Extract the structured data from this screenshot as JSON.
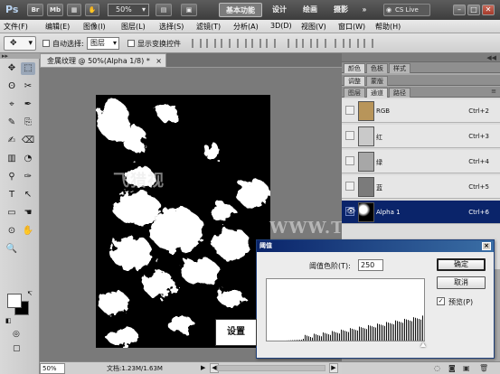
{
  "appbar": {
    "logo": "Ps",
    "bridge": "Br",
    "minibridge": "Mb",
    "zoom": "50%",
    "workspaces": [
      "基本功能",
      "设计",
      "绘画",
      "摄影"
    ],
    "more": "»",
    "cslive": "CS Live",
    "minimize": "–",
    "restore": "□",
    "close": "✕"
  },
  "menubar": {
    "items": [
      "文件(F)",
      "编辑(E)",
      "图像(I)",
      "图层(L)",
      "选择(S)",
      "滤镜(T)",
      "分析(A)",
      "3D(D)",
      "视图(V)",
      "窗口(W)",
      "帮助(H)"
    ]
  },
  "options": {
    "auto_select": "自动选择:",
    "auto_select_value": "图层",
    "show_transform": "显示变换控件"
  },
  "toolbox": {
    "grip": "▸▸",
    "tool_glyphs": [
      "✥",
      "⬚",
      "ʘ",
      "✂",
      "⌖",
      "✒",
      "✎",
      "⎘",
      "✍",
      "⌫",
      "▥",
      "◔",
      "⚲",
      "✑",
      "T",
      "↖",
      "▭",
      "☚",
      "⊙",
      "✋",
      "🔍"
    ],
    "swap": "↸",
    "quickmask": "◎",
    "screenmode": "▢"
  },
  "document": {
    "tab_title": "金属纹理 @ 50%(Alpha 1/8) *",
    "tab_close": "×",
    "watermarks": [
      "飞猎视",
      "WWW.TTLVI.NET"
    ]
  },
  "statusbar": {
    "zoom": "50%",
    "doc_info": "文档:1.23M/1.63M",
    "arrow": "▶",
    "scroll_left": "◀",
    "scroll_right": "▶"
  },
  "panels": {
    "collapse": "◀◀",
    "group1_tabs": [
      "颜色",
      "色板",
      "样式"
    ],
    "group2_tabs": [
      "调整",
      "蒙版"
    ],
    "group3_tabs": [
      "图层",
      "通道",
      "路径"
    ],
    "active_tab": "通道",
    "menu_icon": "≡",
    "channels": [
      {
        "name": "RGB",
        "shortcut": "Ctrl+2",
        "thumb": "#b8955a",
        "visible": false,
        "selected": false
      },
      {
        "name": "红",
        "shortcut": "Ctrl+3",
        "thumb": "#c9c9c9",
        "visible": false,
        "selected": false
      },
      {
        "name": "绿",
        "shortcut": "Ctrl+4",
        "thumb": "#a7a7a7",
        "visible": false,
        "selected": false
      },
      {
        "name": "蓝",
        "shortcut": "Ctrl+5",
        "thumb": "#7b7b7b",
        "visible": false,
        "selected": false
      },
      {
        "name": "Alpha 1",
        "shortcut": "Ctrl+6",
        "thumb": "#000000",
        "visible": true,
        "selected": true
      }
    ],
    "eye_glyph": "👁",
    "footer_icons": [
      "◌",
      "◙",
      "▣",
      "🗑"
    ]
  },
  "threshold": {
    "title": "阈值",
    "close": "×",
    "level_label": "阈值色阶(T):",
    "level_value": "250",
    "ok": "确定",
    "cancel": "取消",
    "preview_label": "预览(P)",
    "preview_checked": true,
    "check_glyph": "✓"
  },
  "callout": {
    "text": "设置"
  }
}
